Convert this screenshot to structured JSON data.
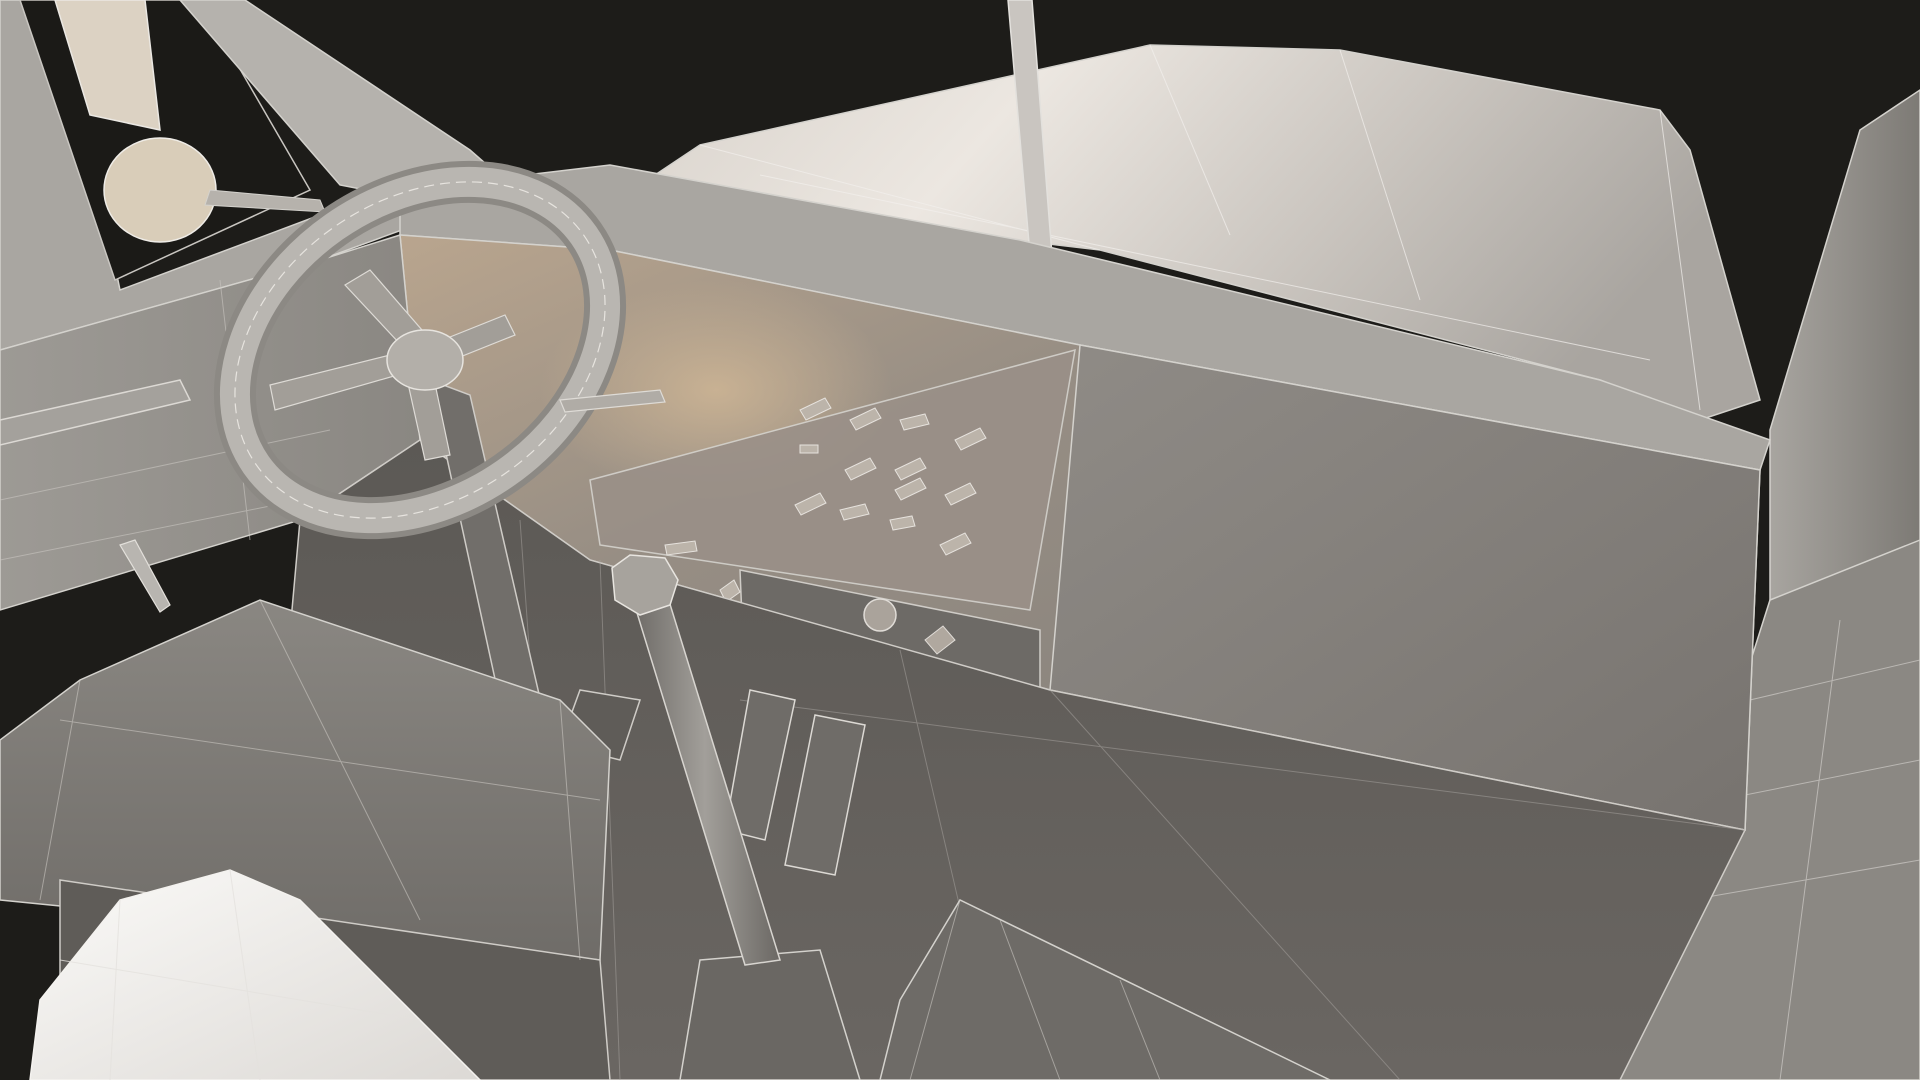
{
  "scene": {
    "subject": "truck-cab-interior-wireframe-render",
    "colors": {
      "background": "#1d1c19",
      "surface_light": "#e9e4dd",
      "surface_mid": "#8e8b86",
      "surface_dark": "#5d5a56",
      "warm_light": "#c4ad8e",
      "wire": "#d4d2cd"
    }
  }
}
